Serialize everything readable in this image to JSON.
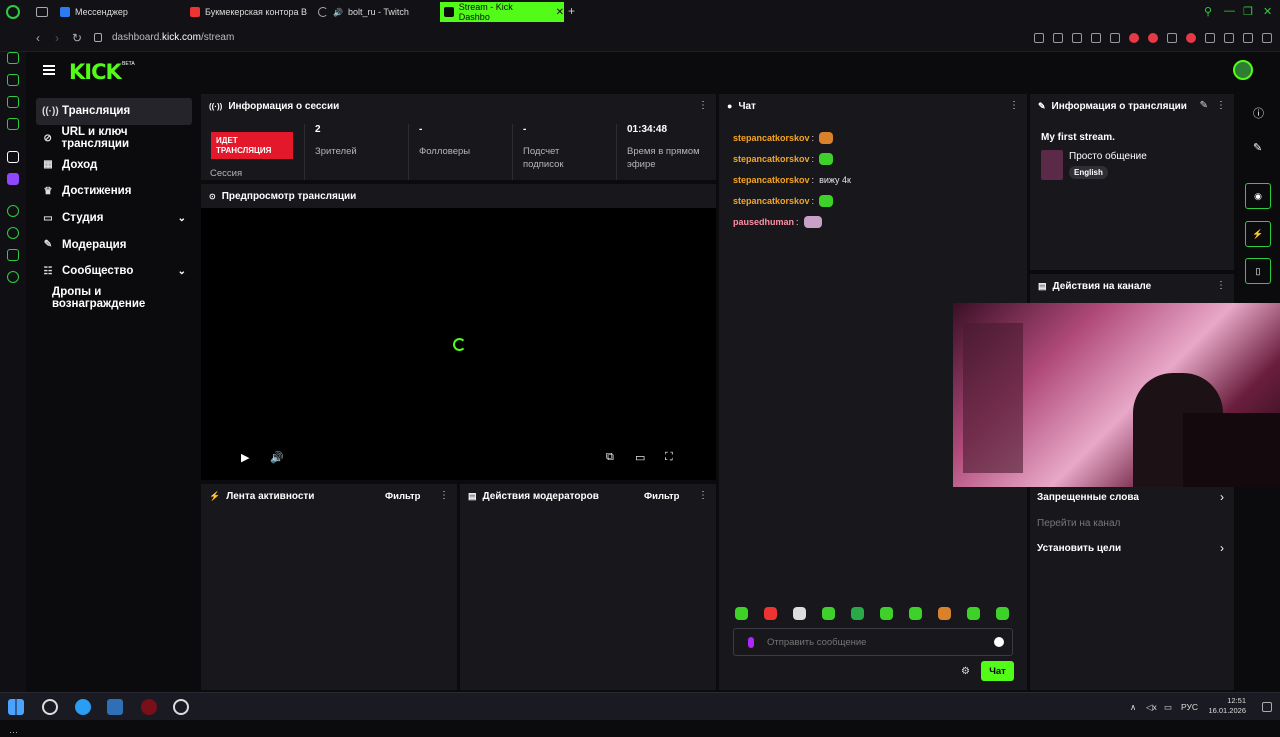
{
  "browser": {
    "tabs": [
      {
        "title": "Мессенджер"
      },
      {
        "title": "Букмекерская контора В"
      },
      {
        "title": "bolt_ru - Twitch"
      },
      {
        "title": "Stream - Kick Dashbo"
      }
    ],
    "url_prefix": "dashboard.",
    "url_host": "kick.com",
    "url_path": "/stream"
  },
  "brand": {
    "logo": "KICK",
    "badge": "BETA",
    "accent": "#53fc18"
  },
  "nav": {
    "items": [
      {
        "label": "Трансляция",
        "icon": "broadcast-icon"
      },
      {
        "label": "URL и ключ трансляции",
        "icon": "link-icon"
      },
      {
        "label": "Доход",
        "icon": "chart-icon"
      },
      {
        "label": "Достижения",
        "icon": "trophy-icon"
      },
      {
        "label": "Студия",
        "icon": "studio-icon"
      },
      {
        "label": "Модерация",
        "icon": "wrench-icon"
      },
      {
        "label": "Сообщество",
        "icon": "users-icon"
      },
      {
        "label": "Дропы и вознаграждение",
        "icon": ""
      }
    ]
  },
  "session": {
    "title": "Информация о сессии",
    "live_label": "ИДЕТ ТРАНСЛЯЦИЯ",
    "session_label": "Сессия",
    "stats": [
      {
        "value": "2",
        "label": "Зрителей"
      },
      {
        "value": "-",
        "label": "Фолловеры"
      },
      {
        "value": "-",
        "label": "Подсчет подписок"
      },
      {
        "value": "01:34:48",
        "label": "Время в прямом эфире"
      }
    ]
  },
  "preview": {
    "title": "Предпросмотр трансляции"
  },
  "activity": {
    "title": "Лента активности",
    "filter": "Фильтр"
  },
  "modactions": {
    "title": "Действия модераторов",
    "filter": "Фильтр"
  },
  "chat": {
    "title": "Чат",
    "messages": [
      {
        "user": "stepancatkorskov",
        "text": ""
      },
      {
        "user": "stepancatkorskov",
        "text": ""
      },
      {
        "user": "stepancatkorskov",
        "text": "вижу 4к"
      },
      {
        "user": "stepancatkorskov",
        "text": ""
      },
      {
        "user": "pausedhuman",
        "text": ""
      }
    ],
    "input_placeholder": "Отправить сообщение",
    "send_label": "Чат"
  },
  "stream_info": {
    "title": "Информация о трансляции",
    "stream_title": "My first stream.",
    "category": "Просто общение",
    "language": "English"
  },
  "channel_actions": {
    "title": "Действия на канале",
    "items": [
      {
        "label": "Запрещенные слова"
      },
      {
        "label": "Перейти на канал"
      },
      {
        "label": "Установить цели"
      }
    ]
  },
  "taskbar": {
    "lang": "РУС",
    "time": "12:51",
    "date": "16.01.2026"
  }
}
